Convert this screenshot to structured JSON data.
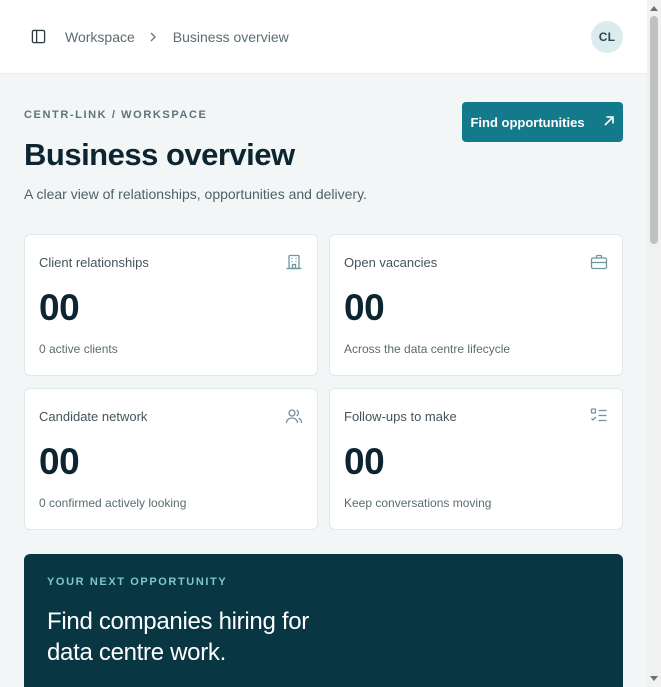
{
  "header": {
    "breadcrumb": [
      "Workspace",
      "Business overview"
    ],
    "avatar_initials": "CL"
  },
  "page": {
    "eyebrow": "CENTR-LINK / WORKSPACE",
    "title": "Business overview",
    "subtitle": "A clear view of relationships, opportunities and delivery.",
    "cta_label": "Find opportunities"
  },
  "stats": [
    {
      "label": "Client relationships",
      "value": "00",
      "caption": "0 active clients",
      "icon": "building-icon"
    },
    {
      "label": "Open vacancies",
      "value": "00",
      "caption": "Across the data centre lifecycle",
      "icon": "briefcase-icon"
    },
    {
      "label": "Candidate network",
      "value": "00",
      "caption": "0 confirmed actively looking",
      "icon": "users-icon"
    },
    {
      "label": "Follow-ups to make",
      "value": "00",
      "caption": "Keep conversations moving",
      "icon": "checklist-icon"
    }
  ],
  "promo": {
    "eyebrow": "YOUR NEXT OPPORTUNITY",
    "title": "Find companies hiring for data centre work."
  },
  "colors": {
    "accent": "#137a8c",
    "promo_bg": "#083643",
    "page_bg": "#f3f6f7"
  }
}
